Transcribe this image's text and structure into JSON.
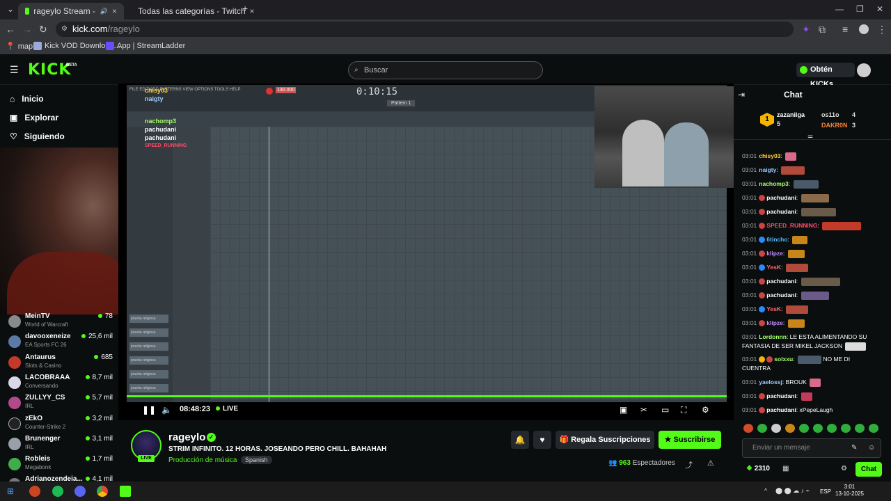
{
  "browser": {
    "tabs": [
      {
        "label": "rageylo Stream - Watch Liv",
        "active": true
      },
      {
        "label": "Todas las categorías - Twitch",
        "active": false
      }
    ],
    "url_domain": "kick.com",
    "url_path": "/rageylo",
    "bookmarks": [
      "map",
      "Kick VOD Download...",
      "App | StreamLadder"
    ]
  },
  "header": {
    "logo": "KICK",
    "logo_tag": "BETA",
    "search_placeholder": "Buscar",
    "get_kicks_label": "Obtén KICKs"
  },
  "sidebar": {
    "nav": [
      {
        "label": "Inicio",
        "icon": "home-icon"
      },
      {
        "label": "Explorar",
        "icon": "compass-icon"
      },
      {
        "label": "Siguiendo",
        "icon": "heart-icon"
      }
    ],
    "channels": [
      {
        "name": "MeinTV",
        "category": "World of Warcraft",
        "viewers": "78"
      },
      {
        "name": "davooxeneize",
        "category": "EA Sports FC 26",
        "viewers": "25,6 mil"
      },
      {
        "name": "Antaurus",
        "category": "Slots & Casino",
        "viewers": "685"
      },
      {
        "name": "LACOBRAAA",
        "category": "Conversando",
        "viewers": "8,7 mil"
      },
      {
        "name": "ZULLYY_CS",
        "category": "IRL",
        "viewers": "5,7 mil"
      },
      {
        "name": "zEkO",
        "category": "Counter-Strike 2",
        "viewers": "3,2 mil"
      },
      {
        "name": "Brunenger",
        "category": "IRL",
        "viewers": "3,1 mil"
      },
      {
        "name": "Robleis",
        "category": "Megabonk",
        "viewers": "1,7 mil"
      },
      {
        "name": "Adrianozendeia...",
        "category": "",
        "viewers": "4,1 mil"
      }
    ]
  },
  "video": {
    "daw_time": "0:10:15",
    "daw_pattern": "Pattern 1",
    "daw_bpm": "130.000",
    "overlay_chat": [
      "chisy03",
      "naigty",
      "nachomp3",
      "pachudani",
      "pachudani",
      "SPEED_RUNNING"
    ],
    "elapsed": "08:48:23",
    "live_label": "LIVE"
  },
  "stream": {
    "streamer": "rageylo",
    "live_badge": "LIVE",
    "title": "STRIM INFINITO. 12 HORAS. JOSEANDO PERO CHILL. BAHAHAH",
    "category": "Producción de música",
    "language": "Spanish",
    "gift_label": "Regala Suscripciones",
    "subscribe_label": "Suscribirse",
    "viewers_count": "963",
    "viewers_label": "Espectadores"
  },
  "chat": {
    "title": "Chat",
    "leaderboard": [
      {
        "rank": "1",
        "name": "zazaniiga",
        "value": "5"
      },
      {
        "rank": "",
        "name": "os11o",
        "value": "4"
      },
      {
        "rank": "",
        "name": "DAKR0N",
        "value": "3"
      }
    ],
    "messages": [
      {
        "time": "03:01",
        "user": "chisy03",
        "text": "",
        "color": "#ffd23f"
      },
      {
        "time": "03:01",
        "user": "naigty",
        "text": "",
        "color": "#9ecbff"
      },
      {
        "time": "03:01",
        "user": "nachomp3",
        "text": "",
        "color": "#a6ff6b"
      },
      {
        "time": "03:01",
        "user": "pachudani",
        "text": "",
        "color": "#ffffff"
      },
      {
        "time": "03:01",
        "user": "pachudani",
        "text": "",
        "color": "#ffffff"
      },
      {
        "time": "03:01",
        "user": "SPEED_RUNNING",
        "text": "",
        "color": "#ff4a6b"
      },
      {
        "time": "03:01",
        "user": "6tincho",
        "text": "",
        "color": "#4fb8ff"
      },
      {
        "time": "03:01",
        "user": "klipze",
        "text": "",
        "color": "#c28bff"
      },
      {
        "time": "03:01",
        "user": "YesK",
        "text": "",
        "color": "#ff6a6a"
      },
      {
        "time": "03:01",
        "user": "pachudani",
        "text": "",
        "color": "#ffffff"
      },
      {
        "time": "03:01",
        "user": "pachudani",
        "text": "",
        "color": "#ffffff"
      },
      {
        "time": "03:01",
        "user": "YesK",
        "text": "",
        "color": "#ff6a6a"
      },
      {
        "time": "03:01",
        "user": "klipze",
        "text": "",
        "color": "#c28bff"
      },
      {
        "time": "03:01",
        "user": "Lordonnn",
        "text": "LE ESTA ALIMENTANDO SU",
        "color": "#a6ff6b"
      },
      {
        "time": "",
        "user": "",
        "text": "FANTASIA DE SER MIKEL JACKSON",
        "color": "#ffffff"
      },
      {
        "time": "03:01",
        "user": "solxxu",
        "text": "NO ME DI",
        "color": "#a6ff6b"
      },
      {
        "time": "",
        "user": "",
        "text": "CUENTRA",
        "color": "#ffffff"
      },
      {
        "time": "03:01",
        "user": "yaelossj",
        "text": "BROUK",
        "color": "#9ecbff"
      },
      {
        "time": "03:01",
        "user": "pachudani",
        "text": "",
        "color": "#ffffff"
      },
      {
        "time": "03:01",
        "user": "pachudani",
        "text": "xPepeLaugh",
        "color": "#ffffff"
      }
    ],
    "input_placeholder": "Enviar un mensaje",
    "kicks_balance": "2310",
    "send_label": "Chat"
  },
  "taskbar": {
    "lang": "ESP",
    "time": "3:01",
    "date": "13-10-2025"
  },
  "colors": {
    "accent": "#53fc18",
    "background": "#0b0e0f"
  }
}
